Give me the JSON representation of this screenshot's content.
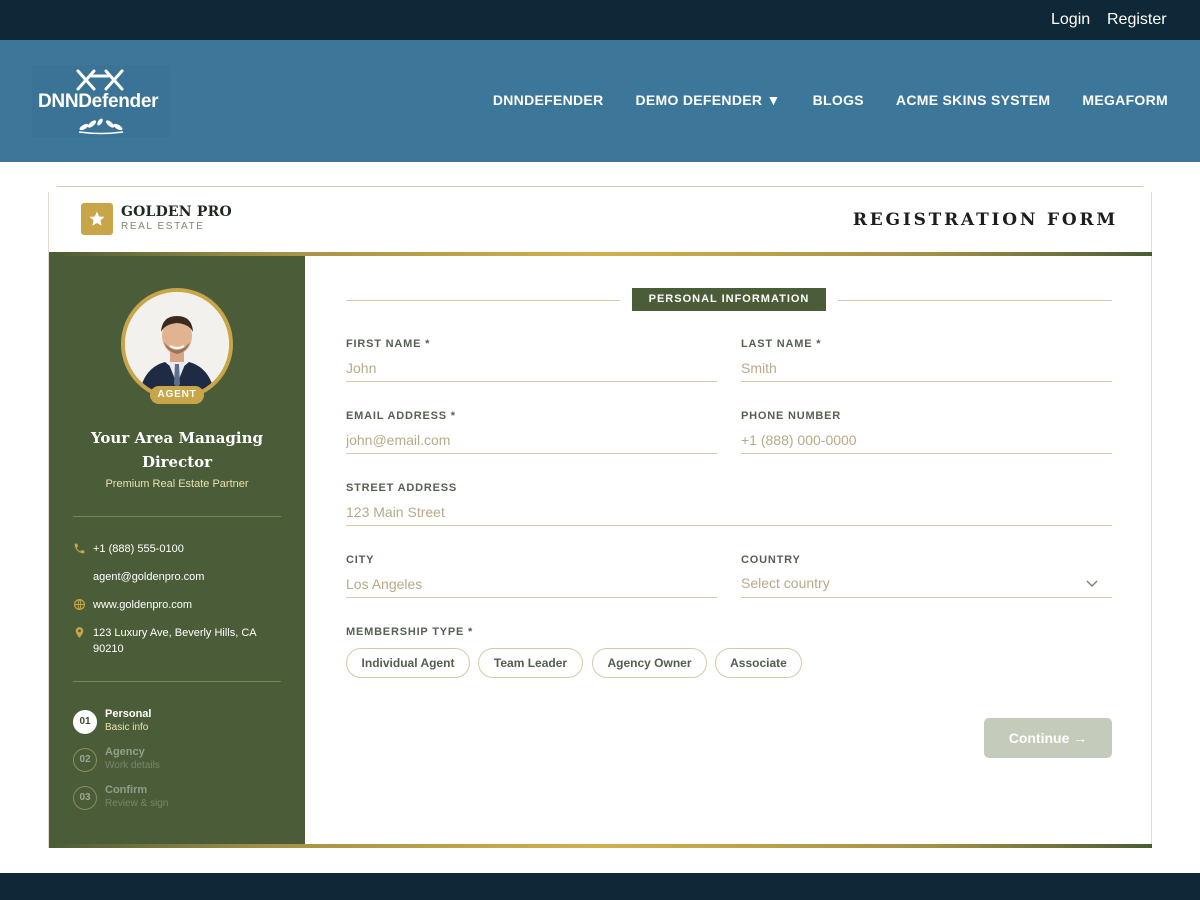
{
  "topbar": {
    "login": "Login",
    "register": "Register"
  },
  "header": {
    "logo_text": "DNNDefender",
    "nav": [
      {
        "label": "DNNDEFENDER"
      },
      {
        "label": "DEMO DEFENDER ▼"
      },
      {
        "label": "BLOGS"
      },
      {
        "label": "ACME SKINS SYSTEM"
      },
      {
        "label": "MEGAFORM"
      }
    ]
  },
  "card": {
    "brand_name": "GOLDEN PRO",
    "brand_sub": "REAL ESTATE",
    "form_title": "REGISTRATION FORM"
  },
  "sidebar": {
    "badge": "AGENT",
    "title": "Your Area Managing Director",
    "subtitle": "Premium Real Estate Partner",
    "contacts": [
      {
        "icon": "phone-icon",
        "text": "+1 (888) 555-0100"
      },
      {
        "icon": "email-icon",
        "text": "agent@goldenpro.com"
      },
      {
        "icon": "globe-icon",
        "text": "www.goldenpro.com"
      },
      {
        "icon": "location-pin-icon",
        "text": "123 Luxury Ave, Beverly Hills, CA 90210"
      }
    ],
    "steps": [
      {
        "num": "01",
        "title": "Personal",
        "sub": "Basic info",
        "active": true
      },
      {
        "num": "02",
        "title": "Agency",
        "sub": "Work details",
        "active": false
      },
      {
        "num": "03",
        "title": "Confirm",
        "sub": "Review & sign",
        "active": false
      }
    ]
  },
  "form": {
    "section_title": "PERSONAL INFORMATION",
    "first_name": {
      "label": "FIRST NAME *",
      "placeholder": "John"
    },
    "last_name": {
      "label": "LAST NAME *",
      "placeholder": "Smith"
    },
    "email": {
      "label": "EMAIL ADDRESS *",
      "placeholder": "john@email.com"
    },
    "phone": {
      "label": "PHONE NUMBER",
      "placeholder": "+1 (888) 000-0000"
    },
    "street": {
      "label": "STREET ADDRESS",
      "placeholder": "123 Main Street"
    },
    "city": {
      "label": "CITY",
      "placeholder": "Los Angeles"
    },
    "country": {
      "label": "COUNTRY",
      "placeholder": "Select country"
    },
    "membership": {
      "label": "MEMBERSHIP TYPE *",
      "options": [
        "Individual Agent",
        "Team Leader",
        "Agency Owner",
        "Associate"
      ]
    },
    "continue_label": "Continue →"
  },
  "colors": {
    "topbar": "#0e2837",
    "header": "#3c7799",
    "sidebar": "#4a5d38",
    "gold": "#c9a54a",
    "continue_disabled": "#c4cbbb"
  }
}
